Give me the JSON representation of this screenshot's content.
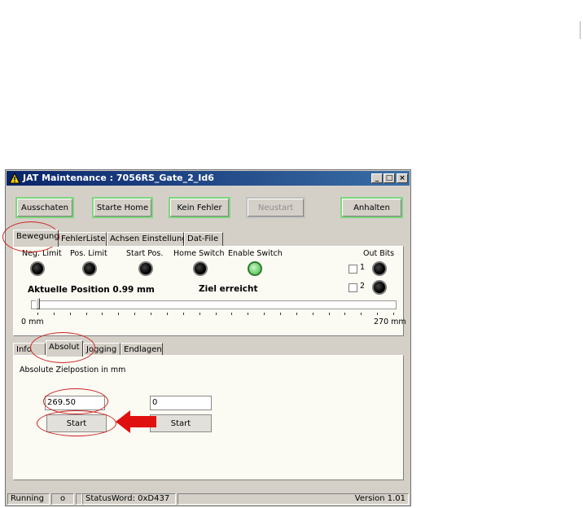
{
  "window": {
    "title": "JAT Maintenance : 7056RS_Gate_2_Id6"
  },
  "toolbar": {
    "buttons": [
      "Ausschaten",
      "Starte Home",
      "Kein Fehler",
      "Neustart",
      "Anhalten"
    ]
  },
  "tabs": [
    "Bewegung",
    "FehlerListe",
    "Achsen Einstellung",
    "Dat-File"
  ],
  "movement": {
    "indicators": [
      {
        "label": "Neg. Limit",
        "state": "off"
      },
      {
        "label": "Pos. Limit",
        "state": "off"
      },
      {
        "label": "Start Pos.",
        "state": "off"
      },
      {
        "label": "Home Switch",
        "state": "off"
      },
      {
        "label": "Enable Switch",
        "state": "on"
      }
    ],
    "out_bits_label": "Out Bits",
    "out_bits": [
      "1",
      "2"
    ],
    "position_text": "Aktuelle Position 0.99 mm",
    "status_text": "Ziel erreicht",
    "scale_min": "0 mm",
    "scale_max": "270 mm",
    "slider_position_fraction": 0.0037
  },
  "subtabs": [
    "Info",
    "Absolut",
    "Jogging",
    "Endlagen"
  ],
  "absolut": {
    "caption": "Absolute Zielpostion in mm",
    "input1": "269.50",
    "input2": "0",
    "start_label": "Start"
  },
  "statusbar": {
    "state": "Running",
    "sep": "o",
    "statusword": "StatusWord: 0xD437",
    "version": "Version 1.01"
  },
  "colors": {
    "highlight": "#cc2222",
    "arrow": "#e01010",
    "led_on": "#6ccf6c",
    "button_border": "#7ed67e"
  }
}
